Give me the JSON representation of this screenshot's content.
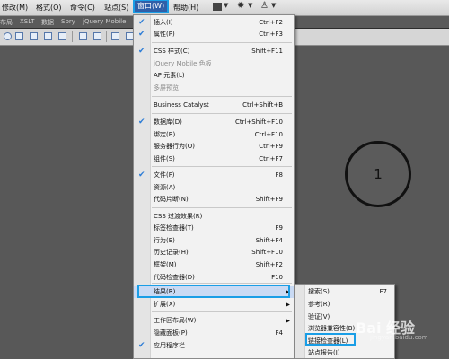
{
  "menubar": {
    "items": [
      "修改(M)",
      "格式(O)",
      "命令(C)",
      "站点(S)",
      "窗口(W)",
      "帮助(H)"
    ]
  },
  "insertbar": {
    "tabs": [
      "布局",
      "XSLT",
      "数据",
      "Spry",
      "jQuery Mobile"
    ]
  },
  "annotation": {
    "label": "1"
  },
  "window_menu": {
    "items": [
      {
        "label": "插入(I)",
        "shortcut": "Ctrl+F2",
        "checked": true
      },
      {
        "label": "属性(P)",
        "shortcut": "Ctrl+F3",
        "checked": true
      },
      {
        "label": "CSS 样式(C)",
        "shortcut": "Shift+F11",
        "checked": true
      },
      {
        "label": "jQuery Mobile 色板",
        "shortcut": "",
        "disabled": true
      },
      {
        "label": "AP 元素(L)",
        "shortcut": ""
      },
      {
        "label": "多屏预览",
        "shortcut": "",
        "disabled": true
      },
      {
        "label": "Business Catalyst",
        "shortcut": "Ctrl+Shift+B"
      },
      {
        "label": "数据库(D)",
        "shortcut": "Ctrl+Shift+F10",
        "checked": true
      },
      {
        "label": "绑定(B)",
        "shortcut": "Ctrl+F10"
      },
      {
        "label": "服务器行为(O)",
        "shortcut": "Ctrl+F9"
      },
      {
        "label": "组件(S)",
        "shortcut": "Ctrl+F7"
      },
      {
        "label": "文件(F)",
        "shortcut": "F8",
        "checked": true
      },
      {
        "label": "资源(A)",
        "shortcut": ""
      },
      {
        "label": "代码片断(N)",
        "shortcut": "Shift+F9"
      },
      {
        "label": "CSS 过渡效果(R)",
        "shortcut": ""
      },
      {
        "label": "标签检查器(T)",
        "shortcut": "F9"
      },
      {
        "label": "行为(E)",
        "shortcut": "Shift+F4"
      },
      {
        "label": "历史记录(H)",
        "shortcut": "Shift+F10"
      },
      {
        "label": "框架(M)",
        "shortcut": "Shift+F2"
      },
      {
        "label": "代码检查器(D)",
        "shortcut": "F10"
      },
      {
        "label": "结果(R)",
        "shortcut": "",
        "submenu": true,
        "highlighted": true
      },
      {
        "label": "扩展(X)",
        "shortcut": "",
        "submenu": true
      },
      {
        "label": "工作区布局(W)",
        "shortcut": "",
        "submenu": true
      },
      {
        "label": "隐藏面板(P)",
        "shortcut": "F4"
      },
      {
        "label": "应用程序栏",
        "shortcut": "",
        "checked": true
      }
    ]
  },
  "results_submenu": {
    "items": [
      {
        "label": "搜索(S)",
        "shortcut": "F7"
      },
      {
        "label": "参考(R)",
        "shortcut": ""
      },
      {
        "label": "验证(V)",
        "shortcut": ""
      },
      {
        "label": "浏览器兼容性(B)",
        "shortcut": ""
      },
      {
        "label": "链接检查器(L)",
        "shortcut": ""
      },
      {
        "label": "站点报告(I)",
        "shortcut": ""
      }
    ]
  },
  "watermark": {
    "text": "Bai 经验",
    "sub": "jingyan.baidu.com"
  }
}
